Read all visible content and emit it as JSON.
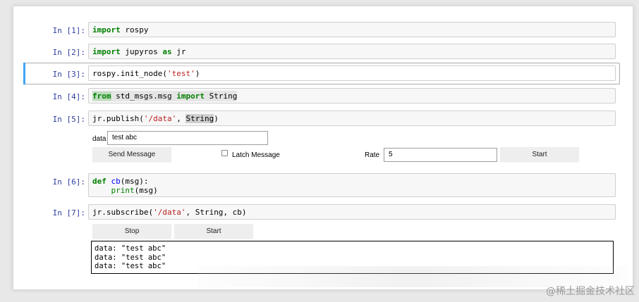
{
  "cells": [
    {
      "prompt": "In [1]:",
      "code": {
        "kw": "import",
        "rest": " rospy"
      }
    },
    {
      "prompt": "In [2]:",
      "code": {
        "kw": "import",
        "mid": " jupyros ",
        "kw2": "as",
        "rest": " jr"
      }
    },
    {
      "prompt": "In [3]:",
      "code": {
        "pre": "rospy.init_node(",
        "str": "'test'",
        "post": ")"
      }
    },
    {
      "prompt": "In [4]:",
      "code": {
        "kw": "from",
        "mid": " std_msgs.msg ",
        "kw2": "import",
        "rest": " String"
      }
    },
    {
      "prompt": "In [5]:",
      "code": {
        "pre": "jr.publish(",
        "str": "'/data'",
        "mid": ", ",
        "hl": "String",
        "post": ")"
      }
    },
    {
      "prompt": "In [6]:",
      "code": {
        "kw": "def",
        "fn": "cb",
        "line1_post": "(msg):",
        "indent": "    ",
        "builtin": "print",
        "line2_post": "(msg)"
      }
    },
    {
      "prompt": "In [7]:",
      "code": {
        "pre": "jr.subscribe(",
        "str": "'/data'",
        "post": ", String, cb)"
      }
    }
  ],
  "publish_widget": {
    "data_label": "data",
    "data_value": "test abc",
    "send_button": "Send Message",
    "latch_label": "Latch Message",
    "latch_checked": false,
    "rate_label": "Rate",
    "rate_value": "5",
    "start_button": "Start"
  },
  "subscribe_widget": {
    "stop_button": "Stop",
    "start_button": "Start",
    "output_lines": "data: \"test abc\"\ndata: \"test abc\"\ndata: \"test abc\""
  },
  "watermark": "@稀土掘金技术社区",
  "colors": {
    "prompt": "#303f9f",
    "keyword": "#008000",
    "string": "#ba2121",
    "function": "#0000ff",
    "selected_bar": "#42a5f5"
  }
}
